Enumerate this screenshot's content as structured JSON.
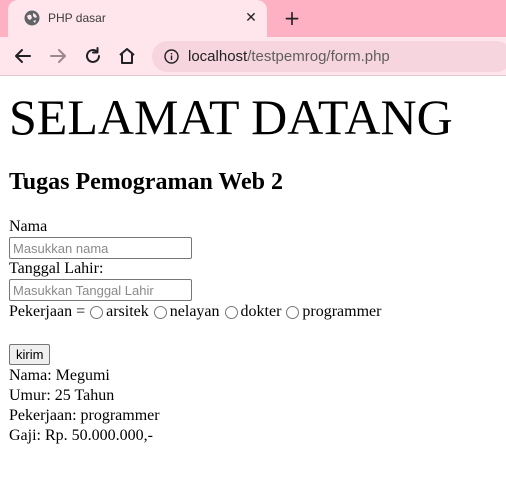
{
  "browser": {
    "tab_title": "PHP dasar",
    "url_host": "localhost",
    "url_path": "/testpemrog/form.php",
    "colors": {
      "tabstrip": "#ffb1c4",
      "toolbar": "#ffe5ec",
      "omnibox": "#f7d5de"
    }
  },
  "page": {
    "heading": "SELAMAT DATANG",
    "subheading": "Tugas Pemograman Web 2",
    "form": {
      "nama_label": "Nama",
      "nama_placeholder": "Masukkan nama",
      "tanggal_label": "Tanggal Lahir:",
      "tanggal_placeholder": "Masukkan Tanggal Lahir",
      "pekerjaan_label": "Pekerjaan =",
      "options": [
        "arsitek",
        "nelayan",
        "dokter",
        "programmer"
      ],
      "submit_label": "kirim"
    },
    "results": [
      "Nama: Megumi",
      "Umur: 25 Tahun",
      "Pekerjaan: programmer",
      "Gaji: Rp. 50.000.000,-"
    ]
  }
}
